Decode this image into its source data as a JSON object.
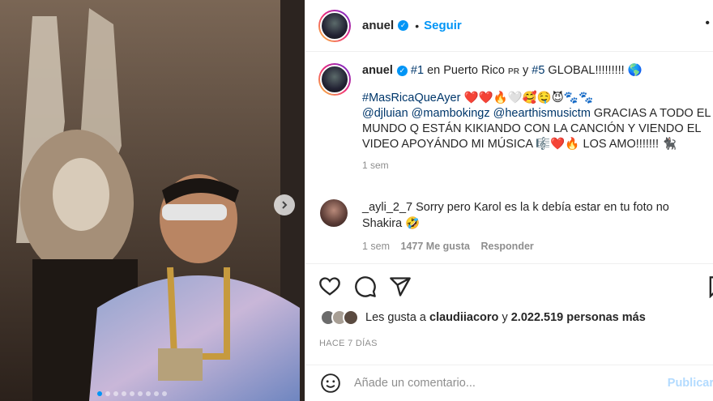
{
  "post": {
    "username": "anuel",
    "follow_label": "Seguir",
    "separator": "•",
    "more_icon": "more-icon"
  },
  "caption": {
    "username": "anuel",
    "line1_parts": [
      "#1",
      " en Puerto Rico ",
      "PR",
      " y ",
      "#5",
      " GLOBAL!!!!!!!!! 🌎"
    ],
    "hashtag": "#MasRicaQueAyer",
    "hashtag_emojis": "❤️❤️🔥🤍🥰🤤😈🐾🐾",
    "mentions": [
      "@djluian",
      "@mambokingz",
      "@hearthismusictm"
    ],
    "text": " GRACIAS A TODO EL MUNDO Q ESTÁN KIKIANDO CON LA CANCIÓN Y VIENDO EL VIDEO APOYÁNDO MI MÚSICA 🎼❤️🔥 LOS AMO!!!!!!! 🐈‍⬛",
    "time": "1 sem"
  },
  "comment": {
    "username": "_ayli_2_7",
    "text": " Sorry pero Karol es la k debía estar en tu foto no Shakira 🤣",
    "time": "1 sem",
    "likes": "1477 Me gusta",
    "reply_label": "Responder"
  },
  "likes": {
    "prefix": "Les gusta a ",
    "user": "claudiiacoro",
    "middle": " y ",
    "count": "2.022.519 personas más"
  },
  "date": "HACE 7 DÍAS",
  "add_comment": {
    "placeholder": "Añade un comentario...",
    "publish_label": "Publicar"
  },
  "carousel": {
    "dots": 9,
    "active_index": 0
  }
}
